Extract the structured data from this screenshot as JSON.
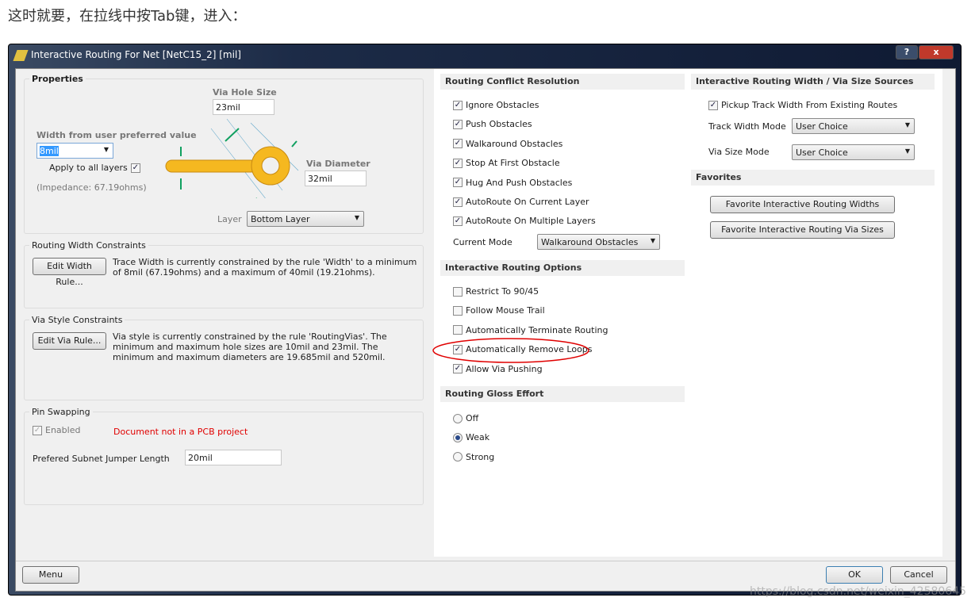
{
  "intro": "这时就要，在拉线中按Tab键，进入：",
  "dialog": {
    "title": "Interactive Routing For Net [NetC15_2] [mil]",
    "help": "?",
    "close": "x"
  },
  "properties": {
    "title": "Properties",
    "via_hole_label": "Via Hole Size",
    "via_hole_value": "23mil",
    "width_label": "Width from user preferred value",
    "width_value": "8mil",
    "apply_all": "Apply to all layers",
    "apply_all_checked": true,
    "impedance": "(Impedance: 67.19ohms)",
    "via_diam_label": "Via Diameter",
    "via_diam_value": "32mil",
    "layer_label": "Layer",
    "layer_value": "Bottom Layer"
  },
  "width_constraints": {
    "title": "Routing Width Constraints",
    "button": "Edit Width Rule...",
    "text": "Trace Width is currently constrained by the rule 'Width' to a minimum of 8mil (67.19ohms) and a maximum of 40mil (19.21ohms)."
  },
  "via_constraints": {
    "title": "Via Style Constraints",
    "button": "Edit Via Rule...",
    "text": "Via style is currently constrained by the rule 'RoutingVias'. The minimum and maximum hole sizes are 10mil and 23mil. The minimum and maximum diameters are 19.685mil and 520mil."
  },
  "pin_swapping": {
    "title": "Pin Swapping",
    "enabled": "Enabled",
    "warning": "Document not in a PCB project",
    "jumper_label": "Prefered Subnet Jumper Length",
    "jumper_value": "20mil"
  },
  "conflict": {
    "title": "Routing Conflict Resolution",
    "items": [
      {
        "label": "Ignore Obstacles",
        "checked": true
      },
      {
        "label": "Push Obstacles",
        "checked": true
      },
      {
        "label": "Walkaround Obstacles",
        "checked": true
      },
      {
        "label": "Stop At First Obstacle",
        "checked": true
      },
      {
        "label": "Hug And Push Obstacles",
        "checked": true
      },
      {
        "label": "AutoRoute On Current Layer",
        "checked": true
      },
      {
        "label": "AutoRoute On Multiple Layers",
        "checked": true
      }
    ],
    "mode_label": "Current Mode",
    "mode_value": "Walkaround Obstacles"
  },
  "options": {
    "title": "Interactive Routing Options",
    "items": [
      {
        "label": "Restrict To 90/45",
        "checked": false
      },
      {
        "label": "Follow Mouse Trail",
        "checked": false
      },
      {
        "label": "Automatically Terminate Routing",
        "checked": false
      },
      {
        "label": "Automatically Remove Loops",
        "checked": true
      },
      {
        "label": "Allow Via Pushing",
        "checked": true
      }
    ]
  },
  "gloss": {
    "title": "Routing Gloss Effort",
    "items": [
      {
        "label": "Off",
        "selected": false
      },
      {
        "label": "Weak",
        "selected": true
      },
      {
        "label": "Strong",
        "selected": false
      }
    ]
  },
  "sources": {
    "title": "Interactive Routing Width / Via Size Sources",
    "pickup": "Pickup Track Width From Existing Routes",
    "pickup_checked": true,
    "track_mode_label": "Track Width Mode",
    "track_mode_value": "User Choice",
    "via_mode_label": "Via Size Mode",
    "via_mode_value": "User Choice"
  },
  "favorites": {
    "title": "Favorites",
    "widths_button": "Favorite Interactive Routing Widths",
    "vias_button": "Favorite Interactive Routing Via Sizes"
  },
  "footer": {
    "menu": "Menu",
    "ok": "OK",
    "cancel": "Cancel"
  },
  "watermark": "https://blog.csdn.net/weixin_42580645",
  "colors": {
    "annotation": "#e00000",
    "warning": "#e00000",
    "via": "#f5b820"
  }
}
